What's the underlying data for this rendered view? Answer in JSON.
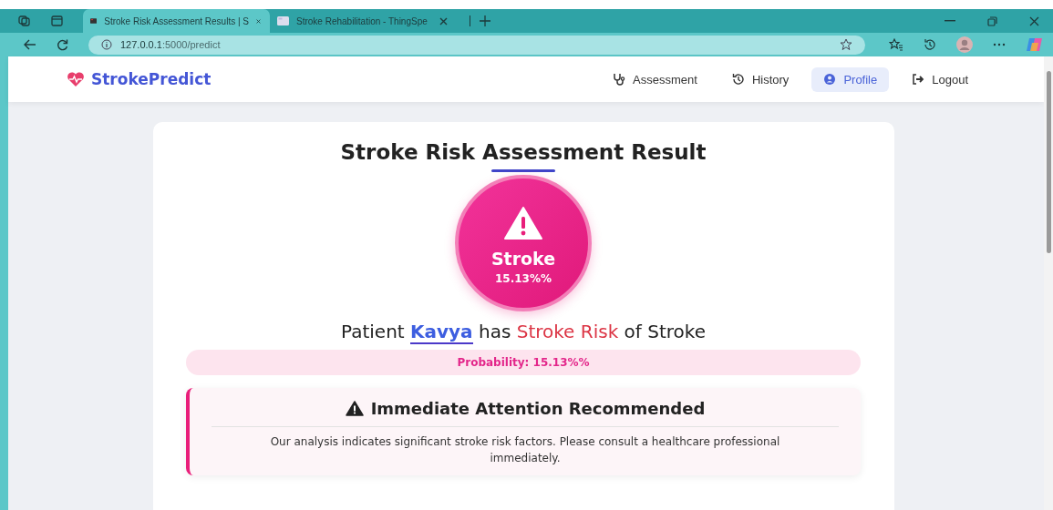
{
  "browser": {
    "tabs": [
      {
        "title": "Stroke Risk Assessment Results | S",
        "selected": true
      },
      {
        "title": "Stroke Rehabilitation - ThingSpe",
        "selected": false
      }
    ],
    "address": {
      "host": "127.0.0.1",
      "path": ":5000/predict"
    }
  },
  "navbar": {
    "brand": "StrokePredict",
    "items": [
      {
        "label": "Assessment",
        "kind": "stethoscope",
        "selected": false
      },
      {
        "label": "History",
        "kind": "history",
        "selected": false
      },
      {
        "label": "Profile",
        "kind": "user",
        "selected": true
      },
      {
        "label": "Logout",
        "kind": "logout",
        "selected": false
      }
    ]
  },
  "result": {
    "title": "Stroke Risk Assessment Result",
    "badge_label": "Stroke",
    "badge_value": "15.13%%",
    "sentence": [
      {
        "kind": "plain",
        "text": "Patient "
      },
      {
        "kind": "name",
        "text": "Kavya"
      },
      {
        "kind": "plain",
        "text": " has "
      },
      {
        "kind": "risk",
        "text": "Stroke Risk"
      },
      {
        "kind": "plain",
        "text": " of Stroke"
      }
    ],
    "probability": "Probability: 15.13%%",
    "alert": {
      "title": "Immediate Attention Recommended",
      "message": "Our analysis indicates significant stroke risk factors. Please consult a healthcare professional immediately."
    }
  }
}
